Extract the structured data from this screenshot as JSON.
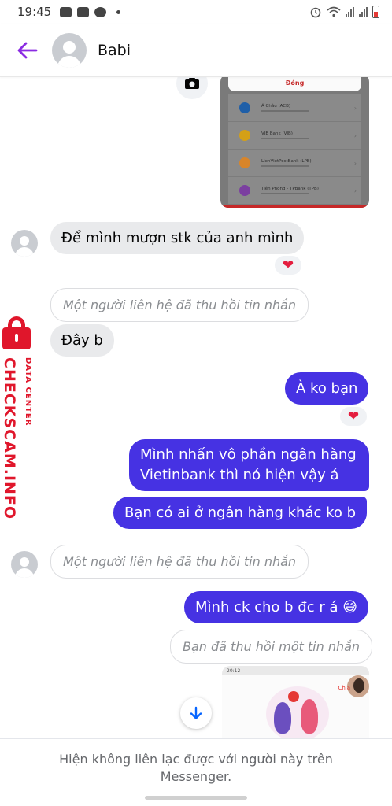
{
  "status_bar": {
    "time": "19:45",
    "left_icons": [
      "youtube-icon",
      "instagram-icon",
      "app-icon"
    ],
    "right_icons": [
      "alarm-icon",
      "wifi-icon",
      "signal-icon",
      "signal-icon",
      "battery-icon"
    ]
  },
  "header": {
    "contact_name": "Babi"
  },
  "shared_screenshot_top": {
    "sheet_button": "Đóng",
    "banks": [
      {
        "name": "Á Châu (ACB)",
        "logo_color": "#1f5fa8"
      },
      {
        "name": "VIB Bank (VIB)",
        "logo_color": "#d4a017"
      },
      {
        "name": "LienVietPostBank (LPB)",
        "logo_color": "#d8852a"
      },
      {
        "name": "Tiên Phong - TPBank (TPB)",
        "logo_color": "#7b3fa0"
      }
    ]
  },
  "messages": {
    "m1": "Để mình mượn stk của anh mình",
    "m1_reaction": "❤",
    "m2_unsent": "Một người liên hệ đã thu hồi tin nhắn",
    "m3": "Đây b",
    "m4": "À ko bạn",
    "m4_reaction": "❤",
    "m5_line1": "Mình nhấn vô phần ngân hàng",
    "m5_line2": "Vietinbank thì nó hiện vậy á",
    "m6": "Bạn có ai ở ngân hàng khác ko b",
    "m7_unsent": "Một người liên hệ đã thu hồi tin nhắn",
    "m8": "Mình ck cho b đc r á 😅",
    "m9_unsent": "Bạn đã thu hồi một tin nhắn"
  },
  "shared_screenshot_bottom": {
    "mini_status": "20:12",
    "chia_label": "Chia"
  },
  "footer": {
    "notice": "Hiện không liên lạc được với người này trên Messenger."
  },
  "watermark": {
    "brand": "CHECKSCAM.INFO",
    "sub": "DATA CENTER"
  },
  "colors": {
    "accent": "#4632e3",
    "back_arrow": "#8a2be2",
    "heart": "#e41e3f",
    "watermark": "#e0162b"
  }
}
